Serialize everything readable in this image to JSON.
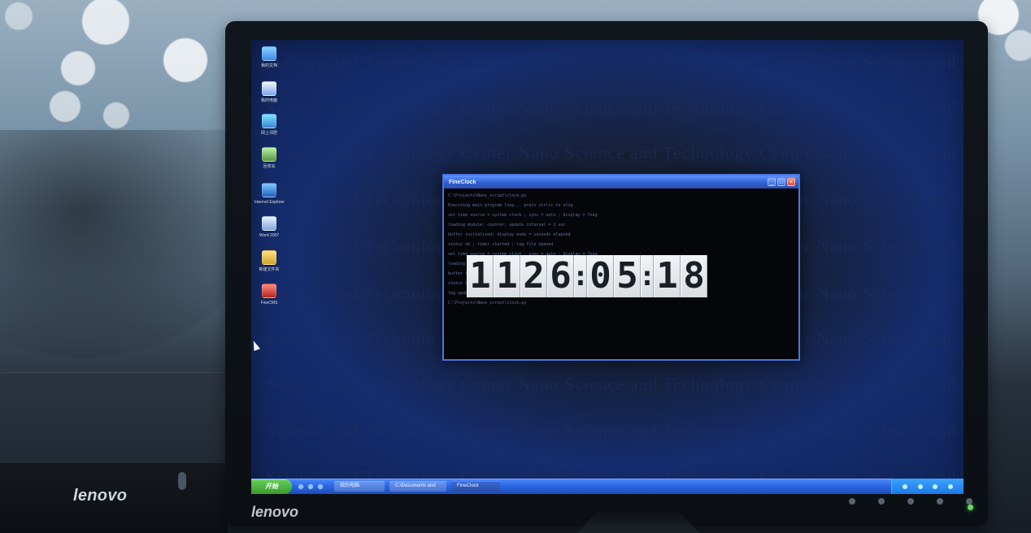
{
  "devices": {
    "pc_logo": "lenovo",
    "monitor_logo": "lenovo"
  },
  "desktop": {
    "wallpaper_text": "Science and Technology Center Nano Science and Technology Center Nano Science and Technology Center Nano Science and Technology",
    "icons": [
      {
        "label": "我的文档"
      },
      {
        "label": "我的电脑"
      },
      {
        "label": "网上邻居"
      },
      {
        "label": "回收站"
      },
      {
        "label": "Internet Explorer"
      },
      {
        "label": "Word 2007"
      },
      {
        "label": "新建文件夹"
      },
      {
        "label": "FineCMS"
      }
    ]
  },
  "console_window": {
    "title": "FineClock",
    "controls": {
      "minimize": "_",
      "maximize": "□",
      "close": "×"
    },
    "lines": [
      "C:\\Projects\\Nano_script\\clock.py",
      "Executing main program loop... press ctrl+c to stop",
      "set time source = system clock ; sync = auto ; display = 7seg",
      "loading module: counter; update interval = 1 sec",
      "buffer initialized; display mode = seconds elapsed",
      "status ok ; timer started ; log file opened",
      "",
      "",
      "",
      "",
      "",
      "",
      "set time source = system clock ; sync = auto ; display = 7seg",
      "loading module: counter; update interval = 1 sec",
      "buffer initialized; display mode = seconds elapsed",
      "status ok ; timer started ; log file opened",
      "log update at 11:26:05 ; process running",
      "C:\\Projects\\Nano_script\\clock.py"
    ],
    "clock": {
      "chars": [
        "1",
        "1",
        "2",
        "6",
        ":",
        "0",
        "5",
        ":",
        "1",
        "8"
      ]
    }
  },
  "taskbar": {
    "start_label": "开始",
    "tasks": [
      {
        "label": "我的电脑"
      },
      {
        "label": "C:\\Documents and"
      },
      {
        "label": "FineClock"
      }
    ]
  }
}
